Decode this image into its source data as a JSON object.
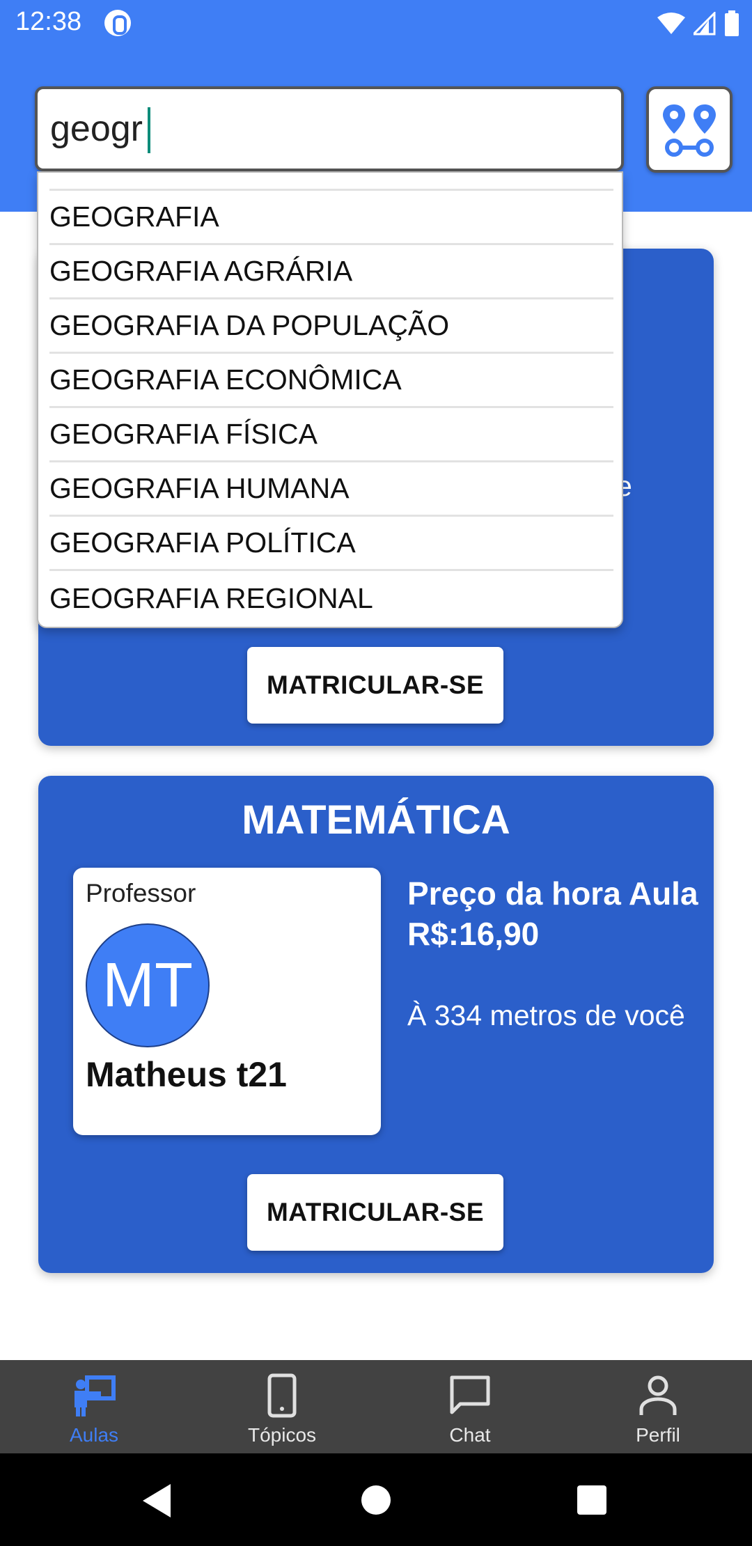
{
  "status_bar": {
    "time": "12:38"
  },
  "search": {
    "value": "geogr",
    "placeholder": ""
  },
  "map_button": {
    "icon": "route-map-icon"
  },
  "suggestions": [
    "GEOGRAFIA",
    "GEOGRAFIA AGRÁRIA",
    "GEOGRAFIA DA POPULAÇÃO",
    "GEOGRAFIA ECONÔMICA",
    "GEOGRAFIA FÍSICA",
    "GEOGRAFIA HUMANA",
    "GEOGRAFIA POLÍTICA",
    "GEOGRAFIA REGIONAL"
  ],
  "card1": {
    "enroll_label": "MATRICULAR-SE",
    "partial_text": "e"
  },
  "card2": {
    "title": "MATEMÁTICA",
    "professor_label": "Professor",
    "avatar_initials": "MT",
    "professor_name": "Matheus t21",
    "price": "Preço da hora Aula R$:16,90",
    "distance": "À 334 metros de você",
    "enroll_label": "MATRICULAR-SE"
  },
  "bottom_nav": [
    {
      "label": "Aulas",
      "icon": "teacher-board-icon",
      "active": true
    },
    {
      "label": "Tópicos",
      "icon": "tablet-icon",
      "active": false
    },
    {
      "label": "Chat",
      "icon": "chat-bubble-icon",
      "active": false
    },
    {
      "label": "Perfil",
      "icon": "person-icon",
      "active": false
    }
  ],
  "colors": {
    "header": "#3f7ef5",
    "card": "#2b5fca",
    "nav_bg": "#424242",
    "nav_active": "#3f7ef5"
  }
}
